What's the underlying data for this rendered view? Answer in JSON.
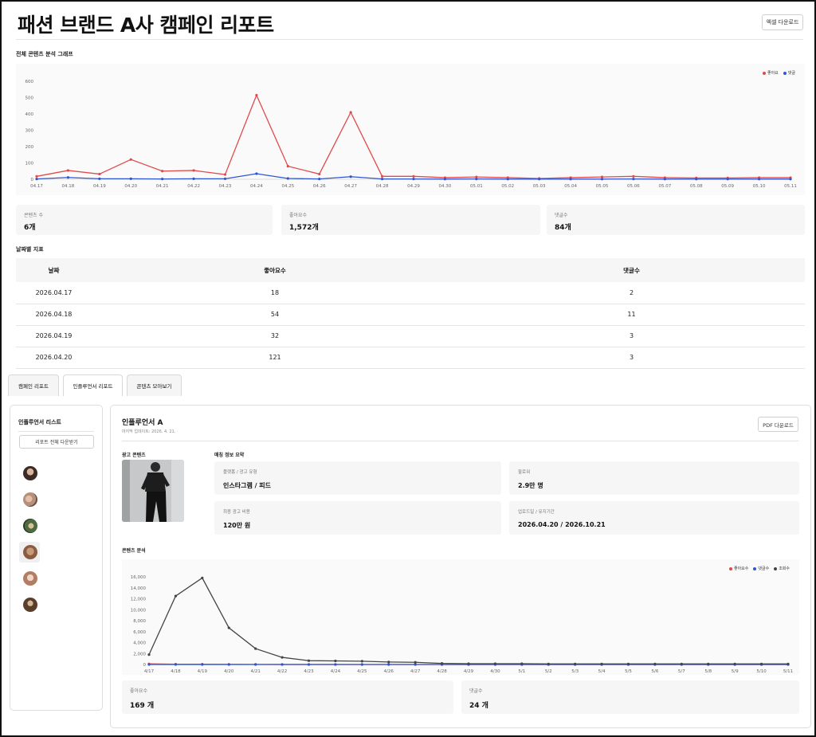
{
  "page": {
    "title": "패션 브랜드 A사 캠페인 리포트",
    "excel_button": "엑셀 다운로드"
  },
  "overall": {
    "section_title": "전체 콘텐츠 분석 그래프",
    "legend": [
      {
        "label": "좋아요",
        "color": "#e24a4a"
      },
      {
        "label": "댓글",
        "color": "#2f55d4"
      }
    ]
  },
  "stats": [
    {
      "label": "콘텐츠 수",
      "value": "6개"
    },
    {
      "label": "좋아요수",
      "value": "1,572개"
    },
    {
      "label": "댓글수",
      "value": "84개"
    }
  ],
  "daily": {
    "section_title": "날짜별 지표",
    "headers": [
      "날짜",
      "좋아요수",
      "댓글수"
    ],
    "rows": [
      [
        "2026.04.17",
        "18",
        "2"
      ],
      [
        "2026.04.18",
        "54",
        "11"
      ],
      [
        "2026.04.19",
        "32",
        "3"
      ],
      [
        "2026.04.20",
        "121",
        "3"
      ]
    ]
  },
  "tabs": [
    {
      "label": "캠페인 리포트",
      "active": false
    },
    {
      "label": "인플루언서 리포트",
      "active": true
    },
    {
      "label": "콘텐츠 모아보기",
      "active": false
    }
  ],
  "influencer_list": {
    "title": "인플루언서 리스트",
    "download_all": "리포트 전체 다운받기",
    "avatar_count": 6,
    "selected_index": 3
  },
  "influencer": {
    "name": "인플루언서 A",
    "updated": "마지막 업데이트: 2026. 4. 21.",
    "pdf_button": "PDF 다운로드",
    "ad_content_title": "광고 콘텐츠",
    "summary_title": "매칭 정보 요약",
    "info": [
      {
        "label": "플랫폼 / 광고 유형",
        "value": "인스타그램 / 피드"
      },
      {
        "label": "팔로워",
        "value": "2.9만 명"
      },
      {
        "label": "최종 광고 비용",
        "value": "120만 원"
      },
      {
        "label": "업로드일 / 유지기간",
        "value": "2026.04.20 / 2026.10.21"
      }
    ],
    "content_analysis_title": "콘텐츠 분석",
    "legend": [
      {
        "label": "좋아요수",
        "color": "#e24a4a"
      },
      {
        "label": "댓글수",
        "color": "#2f55d4"
      },
      {
        "label": "조회수",
        "color": "#444444"
      }
    ],
    "stats": [
      {
        "label": "좋아요수",
        "value": "169 개"
      },
      {
        "label": "댓글수",
        "value": "24 개"
      }
    ]
  },
  "chart_data": [
    {
      "type": "line",
      "x": [
        "04.17",
        "04.18",
        "04.19",
        "04.20",
        "04.21",
        "04.22",
        "04.23",
        "04.24",
        "04.25",
        "04.26",
        "04.27",
        "04.28",
        "04.29",
        "04.30",
        "05.01",
        "05.02",
        "05.03",
        "05.04",
        "05.05",
        "05.06",
        "05.07",
        "05.08",
        "05.09",
        "05.10",
        "05.11"
      ],
      "yticks": [
        0,
        100,
        200,
        300,
        400,
        500,
        600
      ],
      "ylim": [
        0,
        600
      ],
      "series": [
        {
          "name": "좋아요",
          "color": "#e24a4a",
          "values": [
            18,
            54,
            32,
            121,
            50,
            54,
            29,
            515,
            80,
            32,
            410,
            18,
            18,
            10,
            14,
            10,
            5,
            10,
            14,
            18,
            10,
            8,
            8,
            10,
            10
          ]
        },
        {
          "name": "댓글",
          "color": "#2f55d4",
          "values": [
            2,
            11,
            3,
            3,
            2,
            3,
            3,
            34,
            5,
            2,
            16,
            2,
            2,
            1,
            2,
            1,
            1,
            1,
            1,
            2,
            1,
            1,
            1,
            1,
            1
          ]
        }
      ],
      "legend_position": "top-right",
      "grid": false
    },
    {
      "type": "line",
      "x": [
        "4/17",
        "4/18",
        "4/19",
        "4/20",
        "4/21",
        "4/22",
        "4/23",
        "4/24",
        "4/25",
        "4/26",
        "4/27",
        "4/28",
        "4/29",
        "4/30",
        "5/1",
        "5/2",
        "5/3",
        "5/4",
        "5/5",
        "5/6",
        "5/7",
        "5/8",
        "5/9",
        "5/10",
        "5/11"
      ],
      "yticks": [
        0,
        2000,
        4000,
        6000,
        8000,
        10000,
        12000,
        14000,
        16000
      ],
      "ytick_labels": [
        "0",
        "2,000",
        "4,000",
        "6,000",
        "8,000",
        "10,000",
        "12,000",
        "14,000",
        "16,000"
      ],
      "ylim": [
        0,
        16000
      ],
      "series": [
        {
          "name": "좋아요수",
          "color": "#e24a4a",
          "values": [
            121,
            50,
            54,
            29,
            15,
            10,
            8,
            6,
            5,
            4,
            3,
            3,
            3,
            3,
            2,
            2,
            2,
            2,
            2,
            2,
            2,
            2,
            2,
            2,
            2
          ]
        },
        {
          "name": "댓글수",
          "color": "#2f55d4",
          "values": [
            3,
            2,
            3,
            3,
            1,
            1,
            1,
            1,
            1,
            1,
            1,
            1,
            1,
            1,
            1,
            1,
            1,
            1,
            1,
            1,
            1,
            1,
            1,
            1,
            1
          ]
        },
        {
          "name": "조회수",
          "color": "#444444",
          "values": [
            1800,
            12500,
            15800,
            6700,
            2900,
            1300,
            700,
            650,
            600,
            450,
            400,
            200,
            150,
            150,
            150,
            100,
            100,
            100,
            100,
            100,
            100,
            100,
            100,
            100,
            100
          ]
        }
      ],
      "legend_position": "top-right",
      "grid": false
    }
  ]
}
